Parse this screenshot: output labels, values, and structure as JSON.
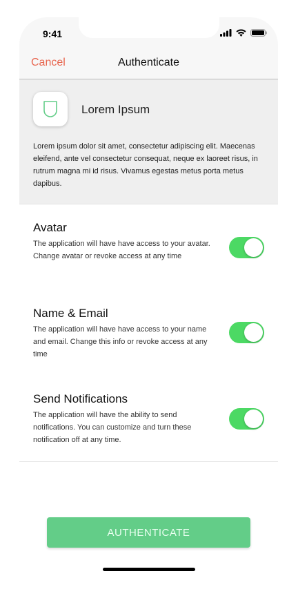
{
  "status_bar": {
    "time": "9:41"
  },
  "nav": {
    "cancel_label": "Cancel",
    "title": "Authenticate"
  },
  "app": {
    "name": "Lorem Ipsum",
    "icon": "shield-icon",
    "description": "Lorem ipsum dolor sit amet, consectetur adipiscing elit. Maecenas eleifend, ante vel consectetur consequat, neque ex laoreet risus, in rutrum magna mi id risus. Vivamus egestas metus porta metus dapibus."
  },
  "permissions": [
    {
      "title": "Avatar",
      "description": "The application will have have access to your avatar. Change avatar or revoke access at any time",
      "enabled": true
    },
    {
      "title": "Name & Email",
      "description": "The application will have have access to your name and email. Change this info or revoke access at any time",
      "enabled": true
    },
    {
      "title": "Send Notifications",
      "description": "The application will have the ability to send notifications. You can customize and turn these notification off at any time.",
      "enabled": true
    }
  ],
  "auth_button_label": "AUTHENTICATE",
  "colors": {
    "accent_cancel": "#e8664f",
    "toggle_on": "#4cd964",
    "button": "#63cd88"
  }
}
